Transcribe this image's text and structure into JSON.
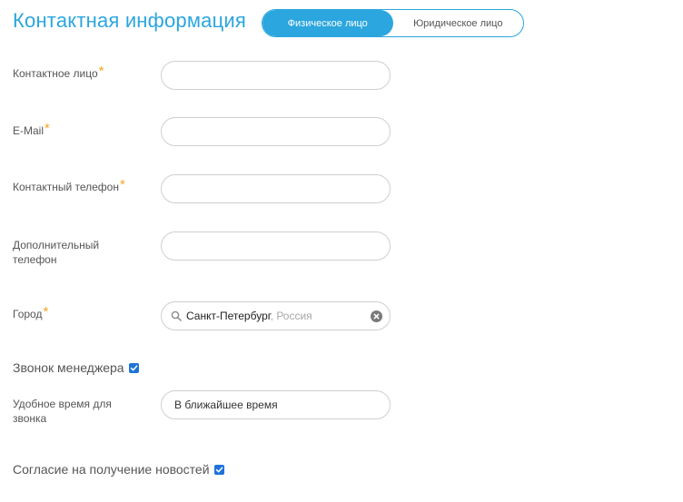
{
  "section": {
    "title": "Контактная информация"
  },
  "tabs": [
    {
      "label": "Физическое лицо",
      "active": true
    },
    {
      "label": "Юридическое лицо",
      "active": false
    }
  ],
  "fields": {
    "contact_person": {
      "label": "Контактное лицо",
      "required_mark": "*",
      "value": ""
    },
    "email": {
      "label": "E-Mail",
      "required_mark": "*",
      "value": ""
    },
    "phone": {
      "label": "Контактный телефон",
      "required_mark": "*",
      "value": ""
    },
    "extra_phone": {
      "label_line1": "Дополнительный",
      "label_line2": "телефон",
      "value": ""
    },
    "city": {
      "label": "Город",
      "required_mark": "*",
      "value": "Санкт-Петербург",
      "country": ", Россия"
    },
    "call_time": {
      "label_line1": "Удобное время для",
      "label_line2": "звонка",
      "value": "В ближайшее время"
    }
  },
  "checkboxes": {
    "manager_call": {
      "label": "Звонок менеджера",
      "checked": true
    },
    "news_consent": {
      "label": "Согласие на получение новостей",
      "checked": true
    }
  },
  "colors": {
    "accent": "#2ba6de",
    "required": "#f5a623",
    "checkbox": "#1e73d8"
  },
  "icons": {
    "city_search": "search-icon",
    "city_clear": "clear-icon",
    "checkmark": "checkmark-icon"
  }
}
